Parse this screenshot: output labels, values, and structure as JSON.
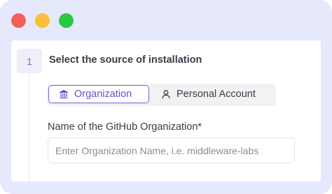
{
  "window": {
    "controls": [
      "close",
      "minimize",
      "maximize"
    ]
  },
  "step": {
    "number": "1",
    "title": "Select the source of installation"
  },
  "source_toggle": {
    "options": [
      {
        "label": "Organization",
        "icon": "building-icon",
        "selected": true
      },
      {
        "label": "Personal Account",
        "icon": "user-icon",
        "selected": false
      }
    ]
  },
  "org_field": {
    "label": "Name of the GitHub Organization*",
    "value": "",
    "placeholder": "Enter Organization Name, i.e. middleware-labs"
  },
  "colors": {
    "frame_bg": "#e6e8fb",
    "accent": "#7b5cd6",
    "close": "#f25f5a",
    "minimize": "#fbbf3a",
    "maximize": "#2ac840"
  }
}
